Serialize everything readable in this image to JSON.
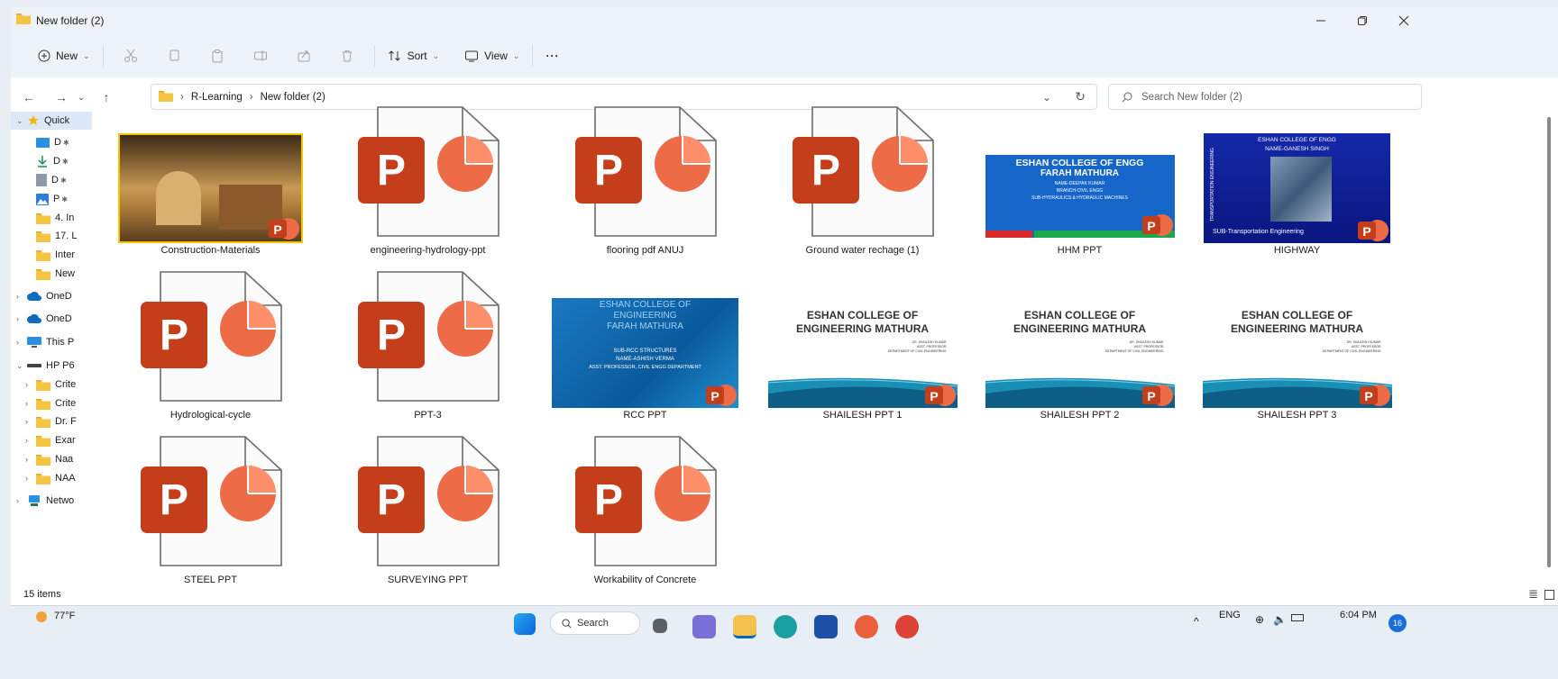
{
  "window": {
    "title": "New folder (2)"
  },
  "toolbar": {
    "new_label": "New",
    "sort_label": "Sort",
    "view_label": "View",
    "more_label": "···"
  },
  "address": {
    "breadcrumb": [
      "R-Learning",
      "New folder (2)"
    ]
  },
  "search": {
    "placeholder": "Search New folder (2)"
  },
  "sidebar": {
    "items": [
      {
        "label": "Quick",
        "icon": "star-icon"
      },
      {
        "label": "D",
        "icon": "desktop-icon"
      },
      {
        "label": "D",
        "icon": "download-icon"
      },
      {
        "label": "D",
        "icon": "document-icon"
      },
      {
        "label": "P",
        "icon": "pictures-icon"
      },
      {
        "label": "4. In",
        "icon": "folder-icon"
      },
      {
        "label": "17. L",
        "icon": "folder-icon"
      },
      {
        "label": "Inter",
        "icon": "folder-icon"
      },
      {
        "label": "New",
        "icon": "folder-icon"
      },
      {
        "label": "OneD",
        "icon": "cloud-icon"
      },
      {
        "label": "OneD",
        "icon": "cloud-icon"
      },
      {
        "label": "This P",
        "icon": "pc-icon"
      },
      {
        "label": "HP P6",
        "icon": "drive-icon"
      },
      {
        "label": "Crite",
        "icon": "folder-icon"
      },
      {
        "label": "Crite",
        "icon": "folder-icon"
      },
      {
        "label": "Dr. F",
        "icon": "folder-icon"
      },
      {
        "label": "Exar",
        "icon": "folder-icon"
      },
      {
        "label": "Naa",
        "icon": "folder-icon"
      },
      {
        "label": "NAA",
        "icon": "folder-icon"
      },
      {
        "label": "Netwo",
        "icon": "network-icon"
      }
    ]
  },
  "files": [
    {
      "name": "Construction-Materials",
      "thumb": "photo"
    },
    {
      "name": "engineering-hydrology-ppt",
      "thumb": "ppt-icon"
    },
    {
      "name": "flooring pdf  ANUJ",
      "thumb": "ppt-icon"
    },
    {
      "name": "Ground water rechage (1)",
      "thumb": "ppt-icon"
    },
    {
      "name": "HHM PPT",
      "thumb": "slide-hhm"
    },
    {
      "name": "HIGHWAY",
      "thumb": "slide-highway"
    },
    {
      "name": "Hydrological-cycle",
      "thumb": "ppt-icon"
    },
    {
      "name": "PPT-3",
      "thumb": "ppt-icon"
    },
    {
      "name": "RCC PPT",
      "thumb": "slide-rcc"
    },
    {
      "name": "SHAILESH PPT 1",
      "thumb": "slide-eshan"
    },
    {
      "name": "SHAILESH PPT 2",
      "thumb": "slide-eshan"
    },
    {
      "name": "SHAILESH PPT 3",
      "thumb": "slide-eshan"
    },
    {
      "name": "STEEL PPT",
      "thumb": "ppt-icon"
    },
    {
      "name": "SURVEYING PPT",
      "thumb": "ppt-icon"
    },
    {
      "name": "Workability of Concrete",
      "thumb": "ppt-icon"
    }
  ],
  "slides": {
    "hhm": {
      "line1": "ESHAN COLLEGE OF ENGG",
      "line2": "FARAH MATHURA",
      "line3": "NAME-DEEPAK KUMAR",
      "line4": "BRANCH-CIVIL ENGG",
      "line5": "SUB-HYDRAULICS & HYDRAULIC MACHINES"
    },
    "highway": {
      "line1": "ESHAN COLLEGE OF ENGG",
      "line2": "NAME-GANESH SINGH",
      "line3": "SUB-Transportation Engineering",
      "side": "TRANSPORTATION ENGINEERING"
    },
    "rcc": {
      "line1": "ESHAN COLLEGE OF",
      "line2": "ENGINEERING",
      "line3": "FARAH MATHURA",
      "line4": "SUB-RCC STRUCTURES",
      "line5": "NAME-ASHISH VERMA",
      "line6": "ASST. PROFESSOR, CIVIL ENGG DEPARTMENT"
    },
    "eshan": {
      "line1": "ESHAN COLLEGE OF",
      "line2": "ENGINEERING MATHURA",
      "small1": "DR. SHAILESH KUMAR",
      "small2": "ASST. PROFESSOR",
      "small3": "DEPARTMENT OF CIVIL ENGINEERING"
    }
  },
  "status": {
    "count": "15 items"
  },
  "taskbar": {
    "weather": "77°F",
    "search": "Search",
    "lang": "ENG",
    "time": "6:04 PM",
    "notif": "16"
  },
  "colors": {
    "ppt_red": "#c43e1c",
    "ppt_orange": "#ed6c47",
    "ppt_light": "#ff8f6b",
    "accent": "#0067c0",
    "folder": "#f4c542"
  }
}
